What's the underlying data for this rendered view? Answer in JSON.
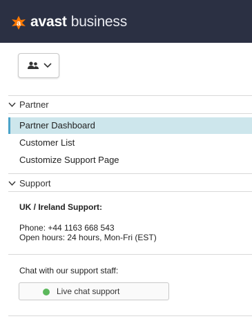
{
  "brand": {
    "name_bold": "avast",
    "name_rest": "business",
    "accent": "#ff7800",
    "header_bg": "#2b3043"
  },
  "view_switcher": {
    "icon": "users-icon",
    "dropdown_icon": "chevron-down-icon"
  },
  "partner_section": {
    "label": "Partner",
    "items": [
      {
        "label": "Partner Dashboard",
        "active": true
      },
      {
        "label": "Customer List",
        "active": false
      },
      {
        "label": "Customize Support Page",
        "active": false
      }
    ]
  },
  "support_section": {
    "label": "Support",
    "region_title": "UK / Ireland Support:",
    "phone": "Phone: +44 1163 668 543",
    "hours": "Open hours: 24 hours, Mon-Fri (EST)",
    "chat_prompt": "Chat with our support staff:",
    "chat_button_label": "Live chat support",
    "chat_status_color": "#5cb85c"
  },
  "colors": {
    "active_item_bg": "#cde6ec",
    "active_item_border": "#4aa3c9"
  }
}
